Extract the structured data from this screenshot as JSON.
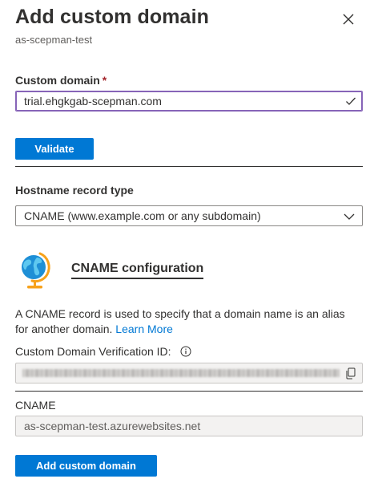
{
  "header": {
    "title": "Add custom domain",
    "subtitle": "as-scepman-test"
  },
  "custom_domain": {
    "label": "Custom domain",
    "required_marker": "*",
    "value": "trial.ehgkgab-scepman.com",
    "valid_icon": "check-icon"
  },
  "validate_button": {
    "label": "Validate"
  },
  "hostname_record": {
    "label": "Hostname record type",
    "selected": "CNAME (www.example.com or any subdomain)"
  },
  "cname_config": {
    "icon": "globe-icon",
    "heading": "CNAME configuration",
    "description": "A CNAME record is used to specify that a domain name is an alias for another domain.",
    "learn_more": "Learn More"
  },
  "verification": {
    "label": "Custom Domain Verification ID:",
    "info_icon": "info-icon",
    "copy_icon": "copy-icon"
  },
  "cname_field": {
    "label": "CNAME",
    "value": "as-scepman-test.azurewebsites.net"
  },
  "submit_button": {
    "label": "Add custom domain"
  },
  "colors": {
    "primary": "#0078d4",
    "required": "#a4262c",
    "focus_border": "#8764b8",
    "text": "#323130"
  }
}
